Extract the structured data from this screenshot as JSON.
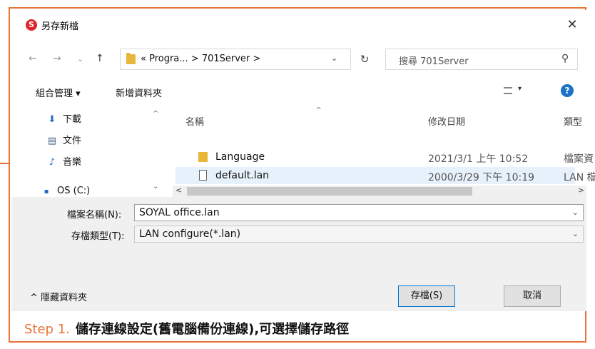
{
  "window": {
    "title": "另存新檔",
    "app_icon": "S"
  },
  "nav": {
    "back_icon": "←",
    "forward_icon": "→",
    "history_icon": "⌄",
    "up_icon": "↑",
    "address": "« Progra... > 701Server >",
    "address_dropdown": "⌄",
    "refresh_icon": "↻",
    "search_placeholder": "搜尋 701Server",
    "search_icon": "⚲"
  },
  "toolbar": {
    "organize": "組合管理 ▾",
    "new_folder": "新增資料夾",
    "view_dropdown": "▾",
    "help": "?"
  },
  "sidebar": {
    "items": [
      {
        "label": "下載",
        "icon": "⬇"
      },
      {
        "label": "文件",
        "icon": "▤"
      },
      {
        "label": "音樂",
        "icon": "♪"
      },
      {
        "label": "OS (C:)",
        "icon": "▪"
      }
    ],
    "scroll_up": "^",
    "scroll_down": "⌄"
  },
  "file_list": {
    "columns": [
      "名稱",
      "修改日期",
      "類型"
    ],
    "rows": [
      {
        "name": "Language",
        "date": "2021/3/1 上午 10:52",
        "type": "檔案資",
        "kind": "folder"
      },
      {
        "name": "default.lan",
        "date": "2000/3/29 下午 10:19",
        "type": "LAN 檔",
        "kind": "file"
      }
    ],
    "scroll_left": "<",
    "scroll_right": ">"
  },
  "form": {
    "filename_label": "檔案名稱(N):",
    "filename_value": "SOYAL office.lan",
    "filetype_label": "存檔類型(T):",
    "filetype_value": "LAN configure(*.lan)",
    "dropdown_icon": "⌄"
  },
  "footer": {
    "hide_folders": "^ 隱藏資料夾",
    "save_button": "存檔(S)",
    "cancel_button": "取消"
  },
  "caption": {
    "step": "Step 1.",
    "text": "儲存連線設定(舊電腦備份連線),可選擇儲存路徑"
  },
  "colors": {
    "accent": "#e8743a",
    "selection": "#e7f1fb",
    "help": "#1a73c8"
  }
}
